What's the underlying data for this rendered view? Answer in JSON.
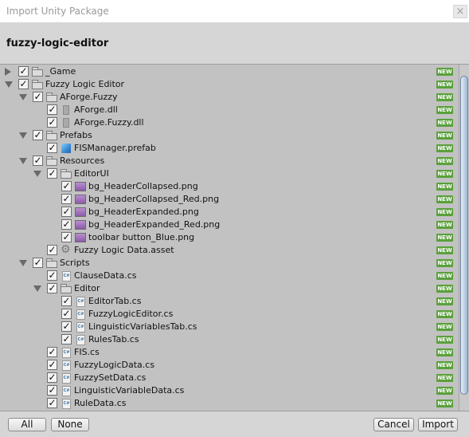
{
  "window": {
    "title": "Import Unity Package",
    "close_glyph": "×"
  },
  "package_name": "fuzzy-logic-editor",
  "badge_text": "NEW",
  "tree": [
    {
      "label": "_Game",
      "depth": 0,
      "arrow": "right",
      "icon": "folder"
    },
    {
      "label": "Fuzzy Logic Editor",
      "depth": 0,
      "arrow": "down",
      "icon": "folder"
    },
    {
      "label": "AForge.Fuzzy",
      "depth": 1,
      "arrow": "down",
      "icon": "folder"
    },
    {
      "label": "AForge.dll",
      "depth": 2,
      "arrow": "",
      "icon": "dll"
    },
    {
      "label": "AForge.Fuzzy.dll",
      "depth": 2,
      "arrow": "",
      "icon": "dll"
    },
    {
      "label": "Prefabs",
      "depth": 1,
      "arrow": "down",
      "icon": "folder"
    },
    {
      "label": "FISManager.prefab",
      "depth": 2,
      "arrow": "",
      "icon": "prefab"
    },
    {
      "label": "Resources",
      "depth": 1,
      "arrow": "down",
      "icon": "folder"
    },
    {
      "label": "EditorUI",
      "depth": 2,
      "arrow": "down",
      "icon": "folder"
    },
    {
      "label": "bg_HeaderCollapsed.png",
      "depth": 3,
      "arrow": "",
      "icon": "png"
    },
    {
      "label": "bg_HeaderCollapsed_Red.png",
      "depth": 3,
      "arrow": "",
      "icon": "png"
    },
    {
      "label": "bg_HeaderExpanded.png",
      "depth": 3,
      "arrow": "",
      "icon": "png"
    },
    {
      "label": "bg_HeaderExpanded_Red.png",
      "depth": 3,
      "arrow": "",
      "icon": "png"
    },
    {
      "label": "toolbar button_Blue.png",
      "depth": 3,
      "arrow": "",
      "icon": "png"
    },
    {
      "label": "Fuzzy Logic Data.asset",
      "depth": 2,
      "arrow": "",
      "icon": "asset"
    },
    {
      "label": "Scripts",
      "depth": 1,
      "arrow": "down",
      "icon": "folder"
    },
    {
      "label": "ClauseData.cs",
      "depth": 2,
      "arrow": "",
      "icon": "cs"
    },
    {
      "label": "Editor",
      "depth": 2,
      "arrow": "down",
      "icon": "folder"
    },
    {
      "label": "EditorTab.cs",
      "depth": 3,
      "arrow": "",
      "icon": "cs"
    },
    {
      "label": "FuzzyLogicEditor.cs",
      "depth": 3,
      "arrow": "",
      "icon": "cs"
    },
    {
      "label": "LinguisticVariablesTab.cs",
      "depth": 3,
      "arrow": "",
      "icon": "cs"
    },
    {
      "label": "RulesTab.cs",
      "depth": 3,
      "arrow": "",
      "icon": "cs"
    },
    {
      "label": "FIS.cs",
      "depth": 2,
      "arrow": "",
      "icon": "cs"
    },
    {
      "label": "FuzzyLogicData.cs",
      "depth": 2,
      "arrow": "",
      "icon": "cs"
    },
    {
      "label": "FuzzySetData.cs",
      "depth": 2,
      "arrow": "",
      "icon": "cs"
    },
    {
      "label": "LinguisticVariableData.cs",
      "depth": 2,
      "arrow": "",
      "icon": "cs"
    },
    {
      "label": "RuleData.cs",
      "depth": 2,
      "arrow": "",
      "icon": "cs"
    }
  ],
  "footer": {
    "all_label": "All",
    "none_label": "None",
    "cancel_label": "Cancel",
    "import_label": "Import"
  },
  "colors": {
    "badge": "#5aa03c",
    "background": "#c2c2c2",
    "header": "#d6d6d6"
  }
}
